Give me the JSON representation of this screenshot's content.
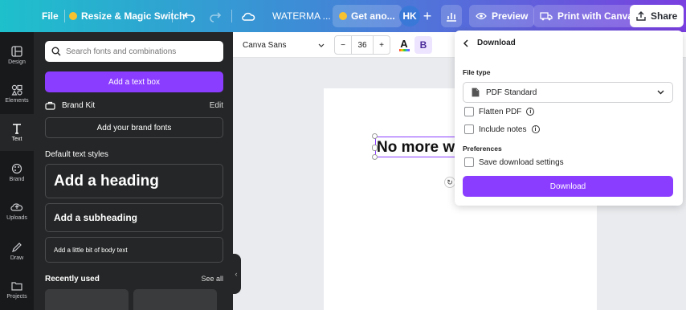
{
  "topbar": {
    "file_label": "File",
    "resize_label": "Resize & Magic Switch",
    "doc_title": "WATERMA ...",
    "get_another_label": "Get ano...",
    "avatar_initials": "HK",
    "preview_label": "Preview",
    "print_label": "Print with Canva",
    "share_label": "Share"
  },
  "rail": {
    "items": [
      {
        "label": "Design",
        "icon": "design-icon"
      },
      {
        "label": "Elements",
        "icon": "elements-icon"
      },
      {
        "label": "Text",
        "icon": "text-icon"
      },
      {
        "label": "Brand",
        "icon": "brand-icon"
      },
      {
        "label": "Uploads",
        "icon": "uploads-icon"
      },
      {
        "label": "Draw",
        "icon": "draw-icon"
      },
      {
        "label": "Projects",
        "icon": "projects-icon"
      }
    ]
  },
  "panel": {
    "search_placeholder": "Search fonts and combinations",
    "add_text_box": "Add a text box",
    "brand_kit": "Brand Kit",
    "edit": "Edit",
    "add_brand_fonts": "Add your brand fonts",
    "default_styles": "Default text styles",
    "heading": "Add a heading",
    "subheading": "Add a subheading",
    "body": "Add a little bit of body text",
    "recently_used": "Recently used",
    "see_all": "See all"
  },
  "editor": {
    "font_name": "Canva Sans",
    "font_size": "36",
    "minus": "−",
    "plus": "+",
    "bold": "B"
  },
  "canvas": {
    "text": "No more w"
  },
  "download": {
    "title": "Download",
    "file_type_label": "File type",
    "file_type_value": "PDF Standard",
    "flatten_pdf": "Flatten PDF",
    "include_notes": "Include notes",
    "preferences_label": "Preferences",
    "save_settings": "Save download settings",
    "download_button": "Download"
  },
  "colors": {
    "accent": "#8b3dff",
    "panel_bg": "#252627",
    "rail_bg": "#18191b"
  }
}
